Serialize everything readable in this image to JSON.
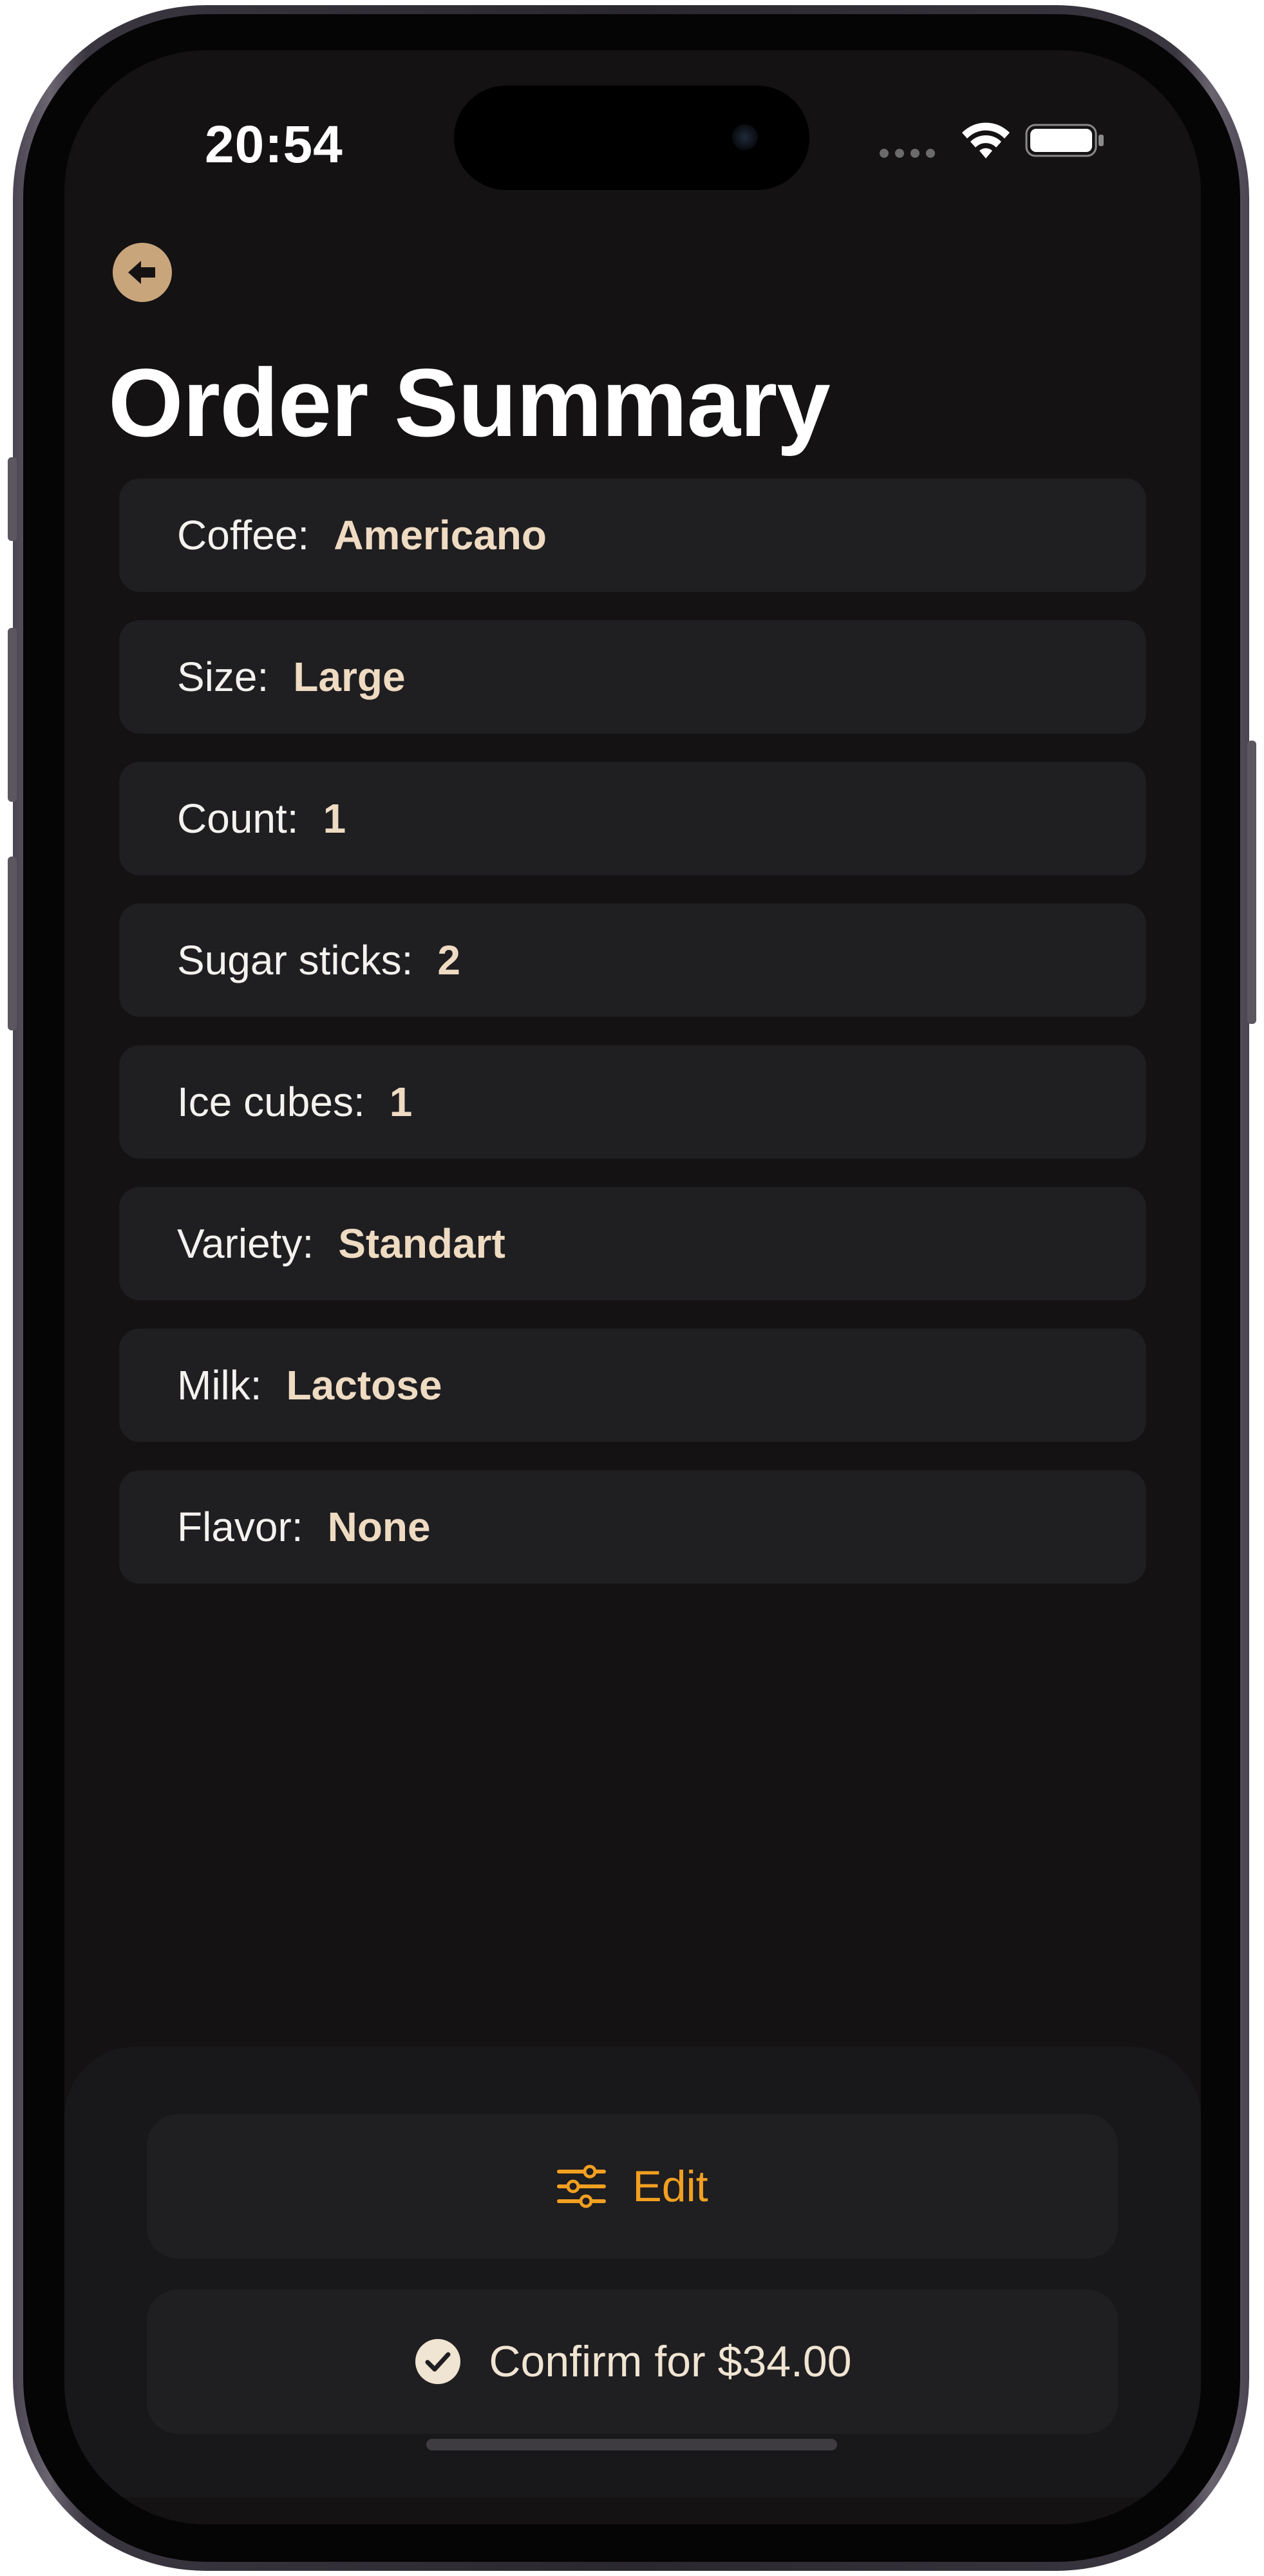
{
  "status_bar": {
    "time": "20:54"
  },
  "header": {
    "back_icon": "arrow-left-circle-icon",
    "title": "Order Summary"
  },
  "summary": {
    "items": [
      {
        "label": "Coffee:",
        "value": "Americano"
      },
      {
        "label": "Size:",
        "value": "Large"
      },
      {
        "label": "Count:",
        "value": "1"
      },
      {
        "label": "Sugar sticks:",
        "value": "2"
      },
      {
        "label": "Ice cubes:",
        "value": "1"
      },
      {
        "label": "Variety:",
        "value": "Standart"
      },
      {
        "label": "Milk:",
        "value": "Lactose"
      },
      {
        "label": "Flavor:",
        "value": "None"
      }
    ]
  },
  "actions": {
    "edit_label": "Edit",
    "edit_icon": "sliders-icon",
    "confirm_label": "Confirm for $34.00",
    "confirm_icon": "checkmark-circle-icon"
  },
  "colors": {
    "background": "#141213",
    "row_background": "#1f1e21",
    "accent": "#f2a021",
    "value_text": "#eedbc2",
    "back_button": "#c9a57c"
  }
}
